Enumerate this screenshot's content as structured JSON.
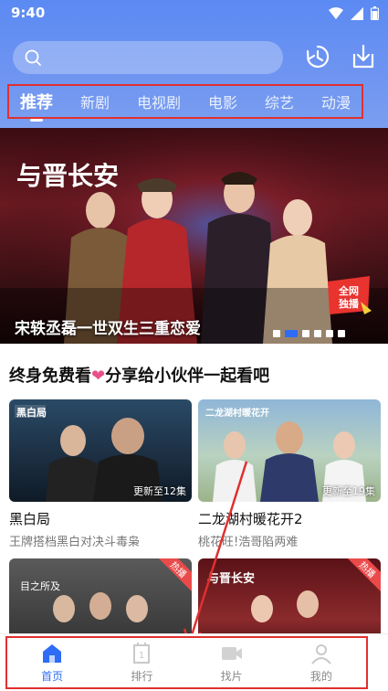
{
  "status_bar": {
    "time": "9:40"
  },
  "search": {
    "placeholder": ""
  },
  "tabs": [
    {
      "label": "推荐",
      "active": true
    },
    {
      "label": "新剧",
      "active": false
    },
    {
      "label": "电视剧",
      "active": false
    },
    {
      "label": "电影",
      "active": false
    },
    {
      "label": "综艺",
      "active": false
    },
    {
      "label": "动漫",
      "active": false
    }
  ],
  "banner": {
    "title_art": "与晋长安",
    "caption": "宋轶丞磊一世双生三重恋爱",
    "badge": "全网独播",
    "dot_count": 6,
    "active_dot": 1
  },
  "section": {
    "title_prefix": "终身免费看",
    "heart": "❤",
    "title_suffix": "分享给小伙伴一起看吧"
  },
  "cards": [
    {
      "title": "黑白局",
      "subtitle": "王牌搭档黑白对决斗毒枭",
      "badge": "更新至12集",
      "thumb_title": "黑白局"
    },
    {
      "title": "二龙湖村暖花开2",
      "subtitle": "桃花旺!浩哥陷两难",
      "badge": "更新至19集",
      "thumb_title": "二龙湖村暖花开"
    },
    {
      "title": "",
      "subtitle": "",
      "badge": "",
      "hot": "热播",
      "thumb_title": "目之所及"
    },
    {
      "title": "",
      "subtitle": "",
      "badge": "",
      "hot": "热播",
      "thumb_title": "与晋长安"
    }
  ],
  "nav": [
    {
      "label": "首页",
      "icon": "home-icon",
      "active": true
    },
    {
      "label": "排行",
      "icon": "ranking-icon",
      "active": false
    },
    {
      "label": "找片",
      "icon": "video-icon",
      "active": false
    },
    {
      "label": "我的",
      "icon": "profile-icon",
      "active": false
    }
  ],
  "colors": {
    "accent": "#2e6cf5",
    "header": "#6f95f1",
    "highlight_box": "#e0302f",
    "heart": "#e8508a"
  }
}
